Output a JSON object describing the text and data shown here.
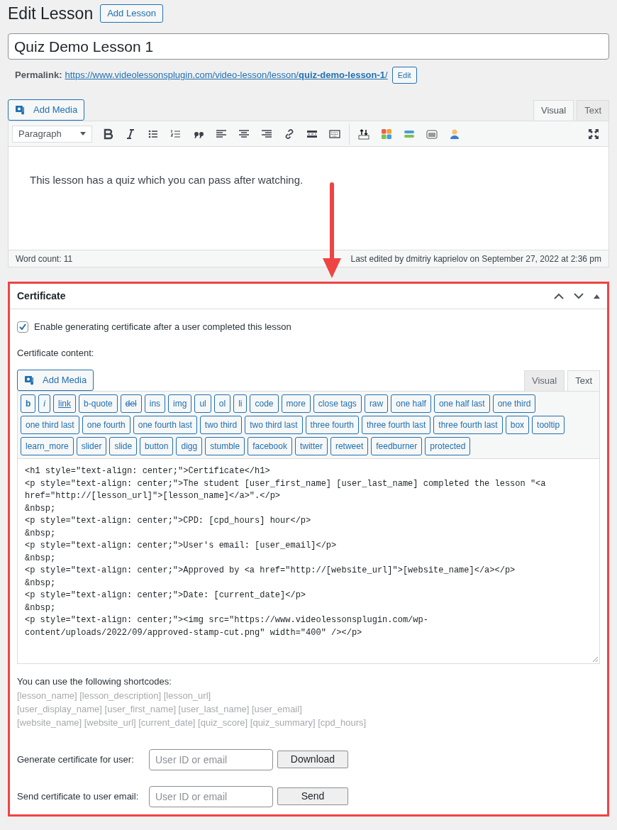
{
  "page_title": "Edit Lesson",
  "add_button": "Add Lesson",
  "post_title": "Quiz Demo Lesson 1",
  "permalink": {
    "label": "Permalink:",
    "url_base": "https://www.videolessonsplugin.com/video-lesson/lesson/",
    "slug": "quiz-demo-lesson-1",
    "trailing": "/",
    "edit": "Edit"
  },
  "editor": {
    "add_media": "Add Media",
    "tabs": [
      {
        "label": "Visual",
        "selected": true
      },
      {
        "label": "Text",
        "selected": false
      }
    ],
    "format": "Paragraph",
    "content": "This lesson has a quiz which you can pass after watching.",
    "word_count": "Word count: 11",
    "last_edited": "Last edited by dmitriy kaprielov on September 27, 2022 at 2:36 pm"
  },
  "certificate": {
    "title": "Certificate",
    "enable": {
      "label": "Enable generating certificate after a user completed this lesson",
      "checked": true
    },
    "content_label": "Certificate content:",
    "add_media": "Add Media",
    "tabs": [
      {
        "label": "Visual",
        "selected": false
      },
      {
        "label": "Text",
        "selected": true
      }
    ],
    "quicktags": [
      {
        "label": "b",
        "kind": "bold"
      },
      {
        "label": "i",
        "kind": "italic"
      },
      {
        "label": "link",
        "kind": "link"
      },
      {
        "label": "b-quote",
        "kind": "plain"
      },
      {
        "label": "del",
        "kind": "deleted"
      },
      {
        "label": "ins",
        "kind": "plain"
      },
      {
        "label": "img",
        "kind": "plain"
      },
      {
        "label": "ul",
        "kind": "plain"
      },
      {
        "label": "ol",
        "kind": "plain"
      },
      {
        "label": "li",
        "kind": "plain"
      },
      {
        "label": "code",
        "kind": "plain"
      },
      {
        "label": "more",
        "kind": "plain"
      },
      {
        "label": "close tags",
        "kind": "plain"
      },
      {
        "label": "raw",
        "kind": "plain"
      },
      {
        "label": "one half",
        "kind": "plain"
      },
      {
        "label": "one half last",
        "kind": "plain"
      },
      {
        "label": "one third",
        "kind": "plain"
      },
      {
        "label": "one third last",
        "kind": "plain"
      },
      {
        "label": "one fourth",
        "kind": "plain"
      },
      {
        "label": "one fourth last",
        "kind": "plain"
      },
      {
        "label": "two third",
        "kind": "plain"
      },
      {
        "label": "two third last",
        "kind": "plain"
      },
      {
        "label": "three fourth",
        "kind": "plain"
      },
      {
        "label": "three fourth last",
        "kind": "plain"
      },
      {
        "label": "three fourth last",
        "kind": "plain"
      },
      {
        "label": "box",
        "kind": "plain"
      },
      {
        "label": "tooltip",
        "kind": "plain"
      },
      {
        "label": "learn_more",
        "kind": "plain"
      },
      {
        "label": "slider",
        "kind": "plain"
      },
      {
        "label": "slide",
        "kind": "plain"
      },
      {
        "label": "button",
        "kind": "plain"
      },
      {
        "label": "digg",
        "kind": "plain"
      },
      {
        "label": "stumble",
        "kind": "plain"
      },
      {
        "label": "facebook",
        "kind": "plain"
      },
      {
        "label": "twitter",
        "kind": "plain"
      },
      {
        "label": "retweet",
        "kind": "plain"
      },
      {
        "label": "feedburner",
        "kind": "plain"
      },
      {
        "label": "protected",
        "kind": "plain"
      }
    ],
    "code_lines": [
      "<h1 style=\"text-align: center;\">Certificate</h1>",
      "<p style=\"text-align: center;\">The student [user_first_name] [user_last_name] completed the lesson \"<a href=\"http://[lesson_url]\">[lesson_name]</a>\".</p>",
      "&nbsp;",
      "<p style=\"text-align: center;\">CPD: [cpd_hours] hour</p>",
      "&nbsp;",
      "<p style=\"text-align: center;\">User's email: [user_email]</p>",
      "&nbsp;",
      "<p style=\"text-align: center;\">Approved by <a href=\"http://[website_url]\">[website_name]</a></p>",
      "&nbsp;",
      "<p style=\"text-align: center;\">Date: [current_date]</p>",
      "&nbsp;",
      "<p style=\"text-align: center;\"><img src=\"https://www.videolessonsplugin.com/wp-content/uploads/2022/09/approved-stamp-cut.png\" width=\"400\" /></p>"
    ],
    "shortcodes_label": "You can use the following shortcodes:",
    "shortcode_lines": [
      "[lesson_name] [lesson_description] [lesson_url]",
      "[user_display_name] [user_first_name] [user_last_name] [user_email]",
      "[website_name] [website_url] [current_date] [quiz_score] [quiz_summary] [cpd_hours]"
    ],
    "actions": [
      {
        "label": "Generate certificate for user:",
        "placeholder": "User ID or email",
        "button": "Download"
      },
      {
        "label": "Send certificate to user email:",
        "placeholder": "User ID or email",
        "button": "Send"
      }
    ]
  }
}
